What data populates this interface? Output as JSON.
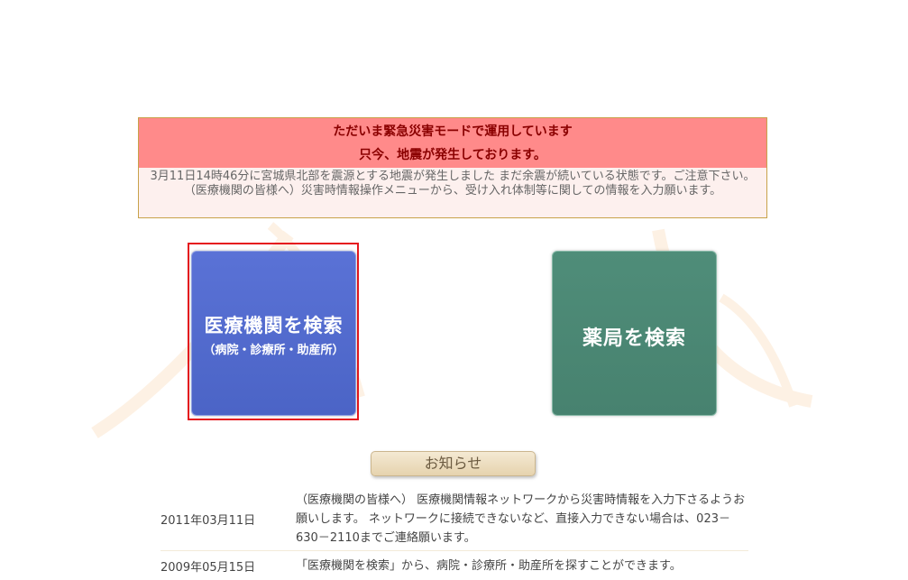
{
  "alert": {
    "line1": "ただいま緊急災害モードで運用しています",
    "line2": "只今、地震が発生しております。",
    "body": "3月11日14時46分に宮城県北部を震源とする地震が発生しました まだ余震が続いている状態です。ご注意下さい。（医療機関の皆様へ）災害時情報操作メニューから、受け入れ体制等に関しての情報を入力願います。"
  },
  "buttons": {
    "medical_main": "医療機関を検索",
    "medical_sub": "（病院・診療所・助産所）",
    "pharmacy_main": "薬局を検索"
  },
  "news": {
    "tab_label": "お知らせ",
    "items": [
      {
        "date": "2011年03月11日",
        "text": "（医療機関の皆様へ） 医療機関情報ネットワークから災害時情報を入力下さるようお願いします。 ネットワークに接続できないなど、直接入力できない場合は、023－630－2110までご連絡願います。"
      },
      {
        "date": "2009年05月15日",
        "text": "「医療機関を検索」から、病院・診療所・助産所を探すことができます。"
      }
    ]
  },
  "colors": {
    "alert_header": "#ff8a8a",
    "alert_text": "#8a0000",
    "medical_button": "#5068c8",
    "pharmacy_button": "#4b8874",
    "selection_frame": "#e5171e"
  }
}
